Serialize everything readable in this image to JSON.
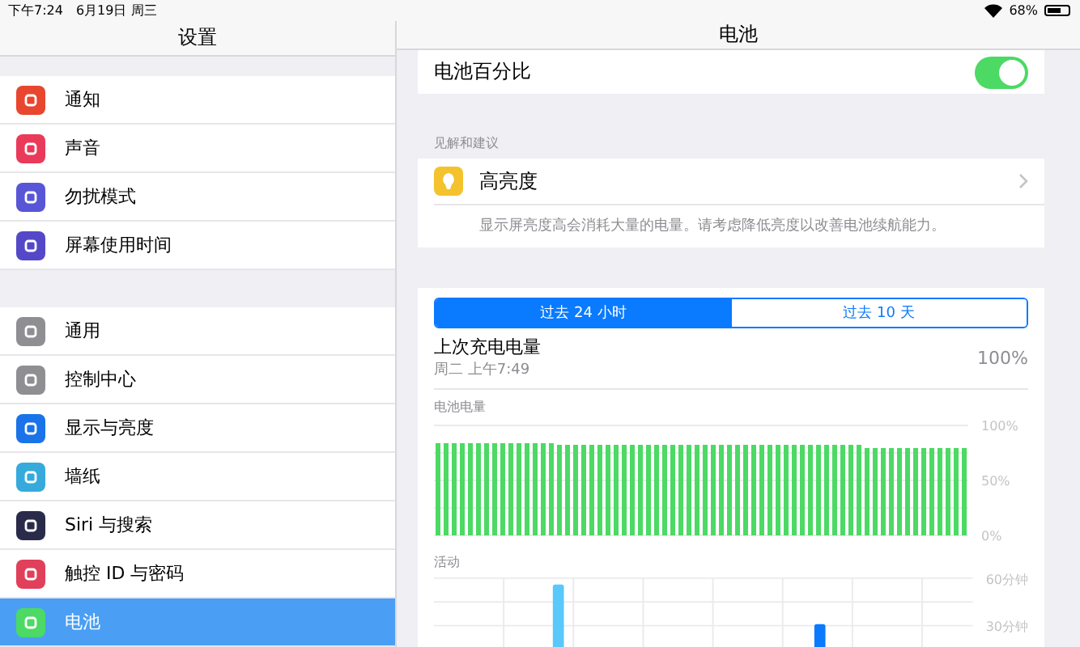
{
  "status_bar": {
    "time": "下午7:24",
    "date": "6月19日 周三",
    "battery_percent": "68%"
  },
  "sidebar": {
    "title": "设置",
    "groups": [
      [
        {
          "label": "通知",
          "color": "#e8462f",
          "selected": false
        },
        {
          "label": "声音",
          "color": "#ea3a5a",
          "selected": false
        },
        {
          "label": "勿扰模式",
          "color": "#5856d6",
          "selected": false
        },
        {
          "label": "屏幕使用时间",
          "color": "#5548c8",
          "selected": false
        }
      ],
      [
        {
          "label": "通用",
          "color": "#8e8e93",
          "selected": false
        },
        {
          "label": "控制中心",
          "color": "#8e8e93",
          "selected": false
        },
        {
          "label": "显示与亮度",
          "color": "#1a73e8",
          "selected": false
        },
        {
          "label": "墙纸",
          "color": "#36aadc",
          "selected": false
        },
        {
          "label": "Siri 与搜索",
          "color": "#2a2a4a",
          "selected": false
        },
        {
          "label": "触控 ID 与密码",
          "color": "#e0405a",
          "selected": false
        },
        {
          "label": "电池",
          "color": "#4cd964",
          "selected": true
        }
      ]
    ]
  },
  "detail": {
    "title": "电池",
    "battery_percentage": {
      "label": "电池百分比",
      "on": true
    },
    "insights": {
      "header": "见解和建议",
      "title": "高亮度",
      "description": "显示屏亮度高会消耗大量的电量。请考虑降低亮度以改善电池续航能力。"
    },
    "tabs": [
      {
        "label": "过去 24 小时",
        "selected": true
      },
      {
        "label": "过去 10 天",
        "selected": false
      }
    ],
    "last_charge": {
      "title": "上次充电电量",
      "time": "周二 上午7:49",
      "value": "100%"
    },
    "battery_chart": {
      "label": "电池电量",
      "chart_data": {
        "type": "bar",
        "ylim": [
          0,
          100
        ],
        "yticks": [
          {
            "value": 100,
            "label": "100%"
          },
          {
            "value": 50,
            "label": "50%"
          },
          {
            "value": 0,
            "label": "0%"
          }
        ],
        "grid": true,
        "values": [
          84,
          84,
          84,
          84,
          84,
          84,
          84,
          84,
          84,
          84,
          84,
          84,
          84,
          84,
          84,
          83,
          83,
          82,
          82,
          82,
          82,
          82,
          82,
          82,
          82,
          82,
          82,
          82,
          82,
          82,
          82,
          82,
          82,
          82,
          82,
          82,
          82,
          82,
          82,
          82,
          82,
          82,
          82,
          82,
          82,
          82,
          82,
          82,
          82,
          82,
          82,
          82,
          82,
          80,
          80,
          80,
          80,
          80,
          80,
          80,
          80,
          80,
          80,
          79,
          79,
          79
        ]
      }
    },
    "activity_chart": {
      "label": "活动",
      "tick_labels": [
        "60分钟",
        "30分钟"
      ]
    }
  }
}
